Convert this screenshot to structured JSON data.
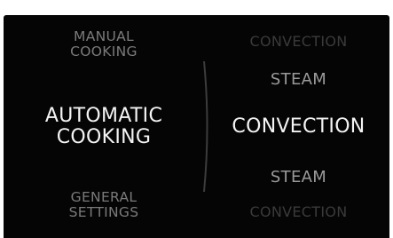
{
  "menu": {
    "left": [
      {
        "lines": [
          "MANUAL",
          "COOKING"
        ],
        "state": "inactive"
      },
      {
        "lines": [
          "AUTOMATIC",
          "COOKING"
        ],
        "state": "selected"
      },
      {
        "lines": [
          "GENERAL",
          "SETTINGS"
        ],
        "state": "inactive"
      }
    ],
    "right": [
      {
        "label": "CONVECTION",
        "state": "far"
      },
      {
        "label": "STEAM",
        "state": "near"
      },
      {
        "label": "CONVECTION",
        "state": "selected"
      },
      {
        "label": "STEAM",
        "state": "near"
      },
      {
        "label": "CONVECTION",
        "state": "far"
      }
    ]
  },
  "colors": {
    "background": "#050505",
    "selected_text": "#f4f4f4",
    "inactive_text": "#7a7a7a",
    "far_text": "#3a3a3a",
    "divider": "#3c3c3c"
  }
}
